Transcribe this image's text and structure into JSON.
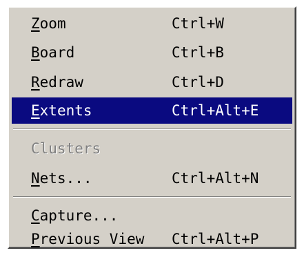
{
  "menu": {
    "items": [
      {
        "mnemonic": "Z",
        "rest": "oom",
        "shortcut": "Ctrl+W"
      },
      {
        "mnemonic": "B",
        "rest": "oard",
        "shortcut": "Ctrl+B"
      },
      {
        "mnemonic": "R",
        "rest": "edraw",
        "shortcut": "Ctrl+D"
      },
      {
        "mnemonic": "E",
        "rest": "xtents",
        "shortcut": "Ctrl+Alt+E",
        "state": "highlighted"
      },
      {
        "label": "Clusters",
        "state": "disabled"
      },
      {
        "mnemonic": "N",
        "rest": "ets...",
        "shortcut": "Ctrl+Alt+N"
      },
      {
        "mnemonic": "C",
        "rest": "apture...",
        "shortcut": ""
      },
      {
        "mnemonic": "P",
        "rest": "revious View",
        "shortcut": "Ctrl+Alt+P"
      }
    ]
  },
  "colors": {
    "menu_background": "#d4d0c8",
    "highlight_background": "#0a0a80",
    "highlight_text": "#ffffff",
    "disabled_text": "#808080"
  }
}
